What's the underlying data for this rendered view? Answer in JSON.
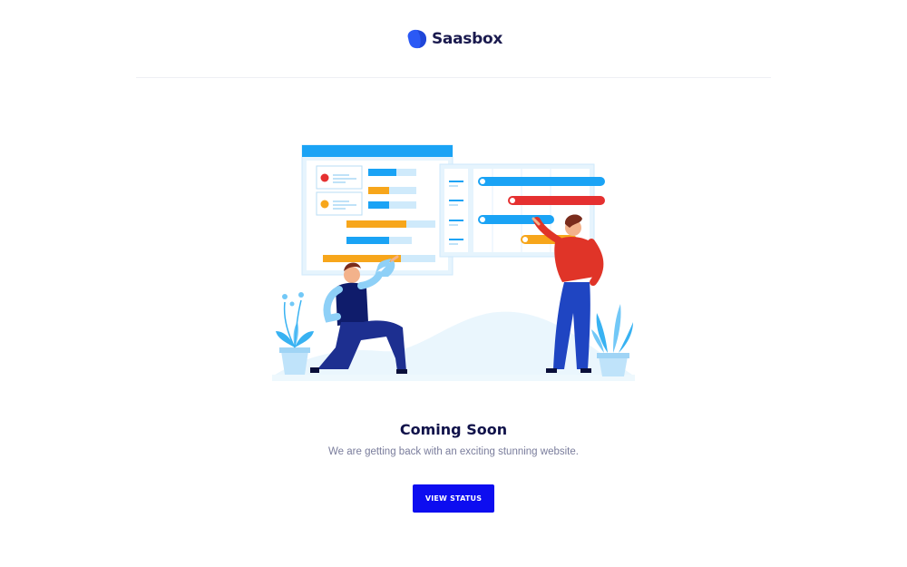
{
  "brand": {
    "name": "Saasbox",
    "logo_icon": "blob-logo-icon",
    "logo_color": "#2b59f5"
  },
  "hero": {
    "illustration_icon": "team-planning-board-illustration",
    "title": "Coming Soon",
    "subtitle": "We are getting back with an exciting stunning website.",
    "button_label": "VIEW STATUS"
  },
  "colors": {
    "accent": "#0d0df0",
    "title": "#10124a",
    "muted": "#7a7d9c"
  }
}
